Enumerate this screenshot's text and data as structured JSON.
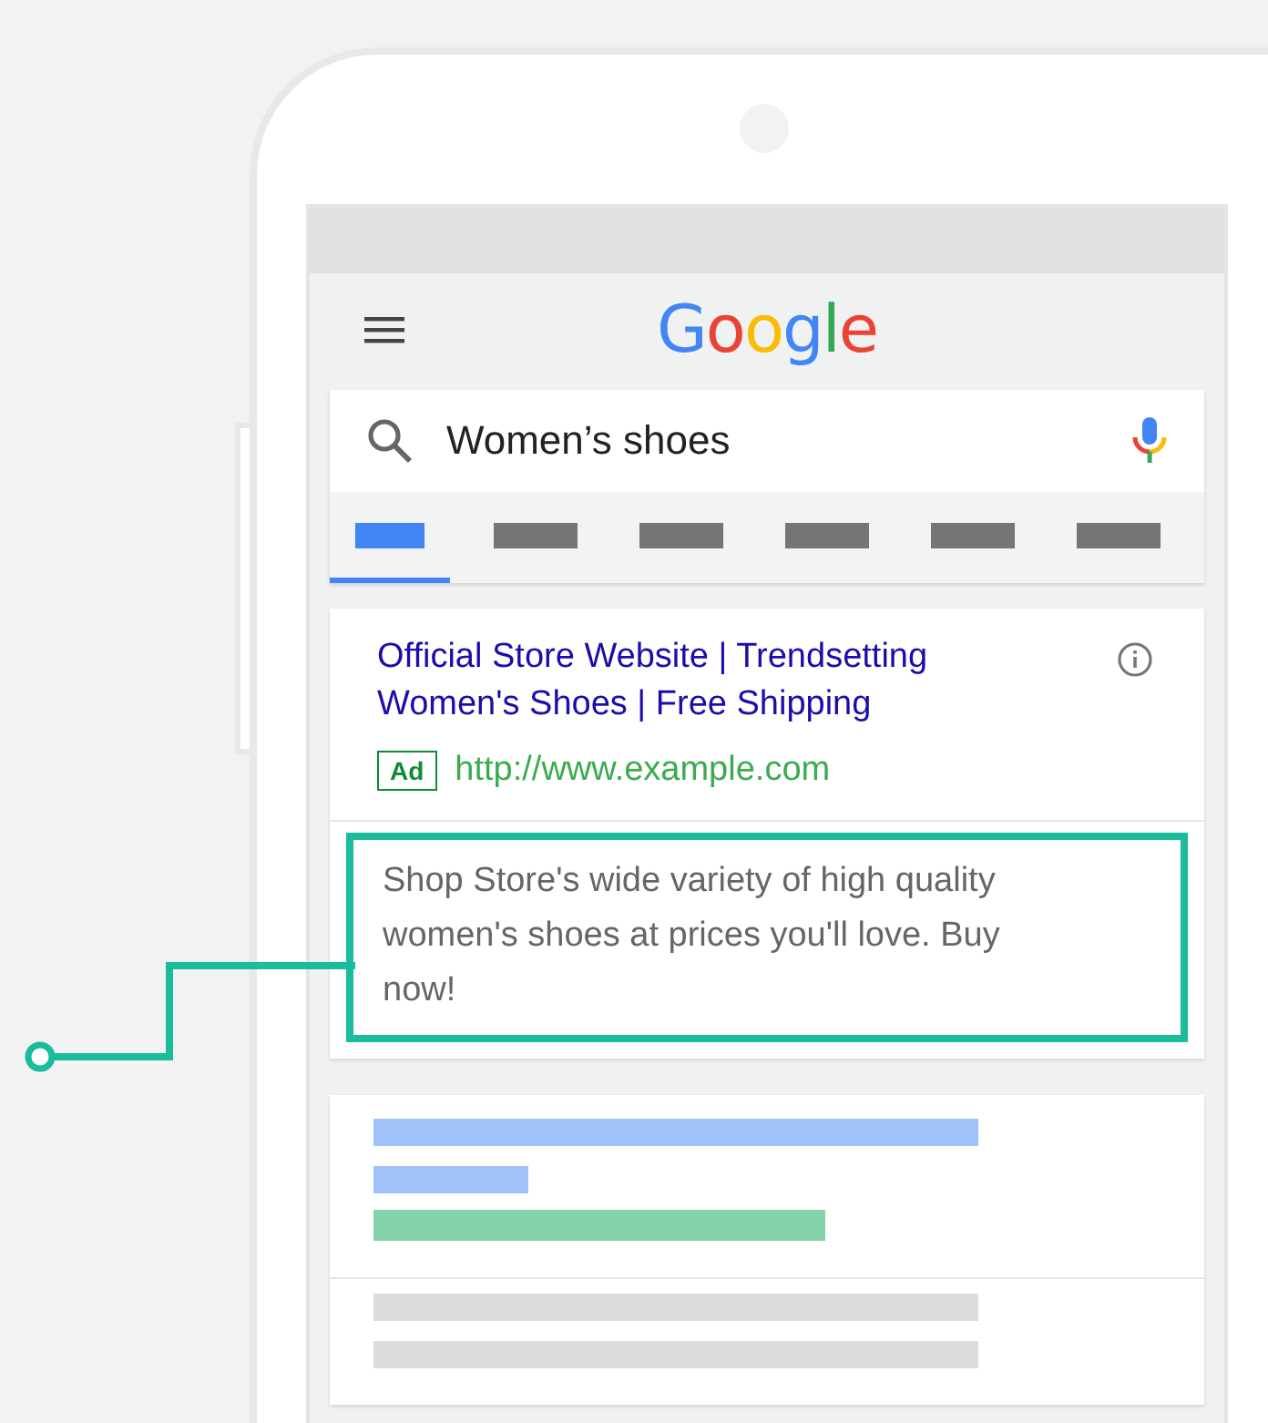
{
  "logo": "Google",
  "search": {
    "query": "Women’s shoes"
  },
  "tabs": [
    {
      "selected": true
    },
    {
      "selected": false
    },
    {
      "selected": false
    },
    {
      "selected": false
    },
    {
      "selected": false
    },
    {
      "selected": false
    }
  ],
  "ad": {
    "title": "Official Store Website | Trendsetting Women's Shoes | Free Shipping",
    "badge": "Ad",
    "url": "http://www.example.com",
    "description": "Shop Store's wide variety of high quality women's shoes at prices you'll love. Buy now!",
    "highlighted": true
  }
}
